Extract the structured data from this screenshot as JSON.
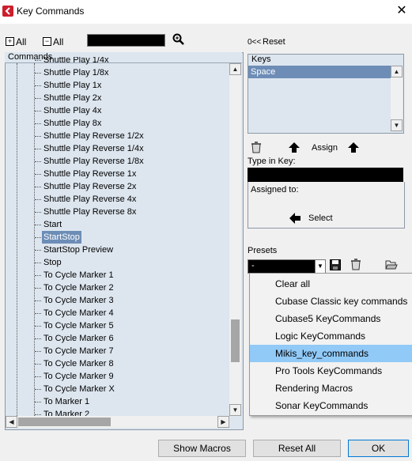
{
  "window": {
    "title": "Key Commands",
    "close_glyph": "✕"
  },
  "toolbar": {
    "expand_all_label": "All",
    "collapse_all_label": "All",
    "reset_label": "Reset",
    "reset_glyph": "0<<"
  },
  "tree": {
    "header": "Commands",
    "items": [
      "Shuttle Play 1/4x",
      "Shuttle Play 1/8x",
      "Shuttle Play 1x",
      "Shuttle Play 2x",
      "Shuttle Play 4x",
      "Shuttle Play 8x",
      "Shuttle Play Reverse 1/2x",
      "Shuttle Play Reverse 1/4x",
      "Shuttle Play Reverse 1/8x",
      "Shuttle Play Reverse 1x",
      "Shuttle Play Reverse 2x",
      "Shuttle Play Reverse 4x",
      "Shuttle Play Reverse 8x",
      "Start",
      "StartStop",
      "StartStop Preview",
      "Stop",
      "To Cycle Marker 1",
      "To Cycle Marker 2",
      "To Cycle Marker 3",
      "To Cycle Marker 4",
      "To Cycle Marker 5",
      "To Cycle Marker 6",
      "To Cycle Marker 7",
      "To Cycle Marker 8",
      "To Cycle Marker 9",
      "To Cycle Marker X",
      "To Marker 1",
      "To Marker 2"
    ],
    "selected": "StartStop"
  },
  "keys": {
    "header": "Keys",
    "items": [
      "Space"
    ]
  },
  "assign": {
    "label": "Assign"
  },
  "type_in_key": {
    "label": "Type in Key:",
    "value": ""
  },
  "assigned_to": {
    "label": "Assigned to:"
  },
  "select": {
    "label": "Select"
  },
  "presets": {
    "label": "Presets",
    "value": "-",
    "options": [
      "Clear all",
      "Cubase Classic key commands",
      "Cubase5 KeyCommands",
      "Logic KeyCommands",
      "Mikis_key_commands",
      "Pro Tools KeyCommands",
      "Rendering Macros",
      "Sonar KeyCommands"
    ],
    "highlighted": "Mikis_key_commands"
  },
  "buttons": {
    "show_macros": "Show Macros",
    "reset_all": "Reset All",
    "ok": "OK"
  },
  "colors": {
    "selection": "#6d8db6",
    "list_background": "#dde6ef",
    "menu_highlight": "#91c9f7",
    "app_icon_red": "#cc1f2d"
  }
}
